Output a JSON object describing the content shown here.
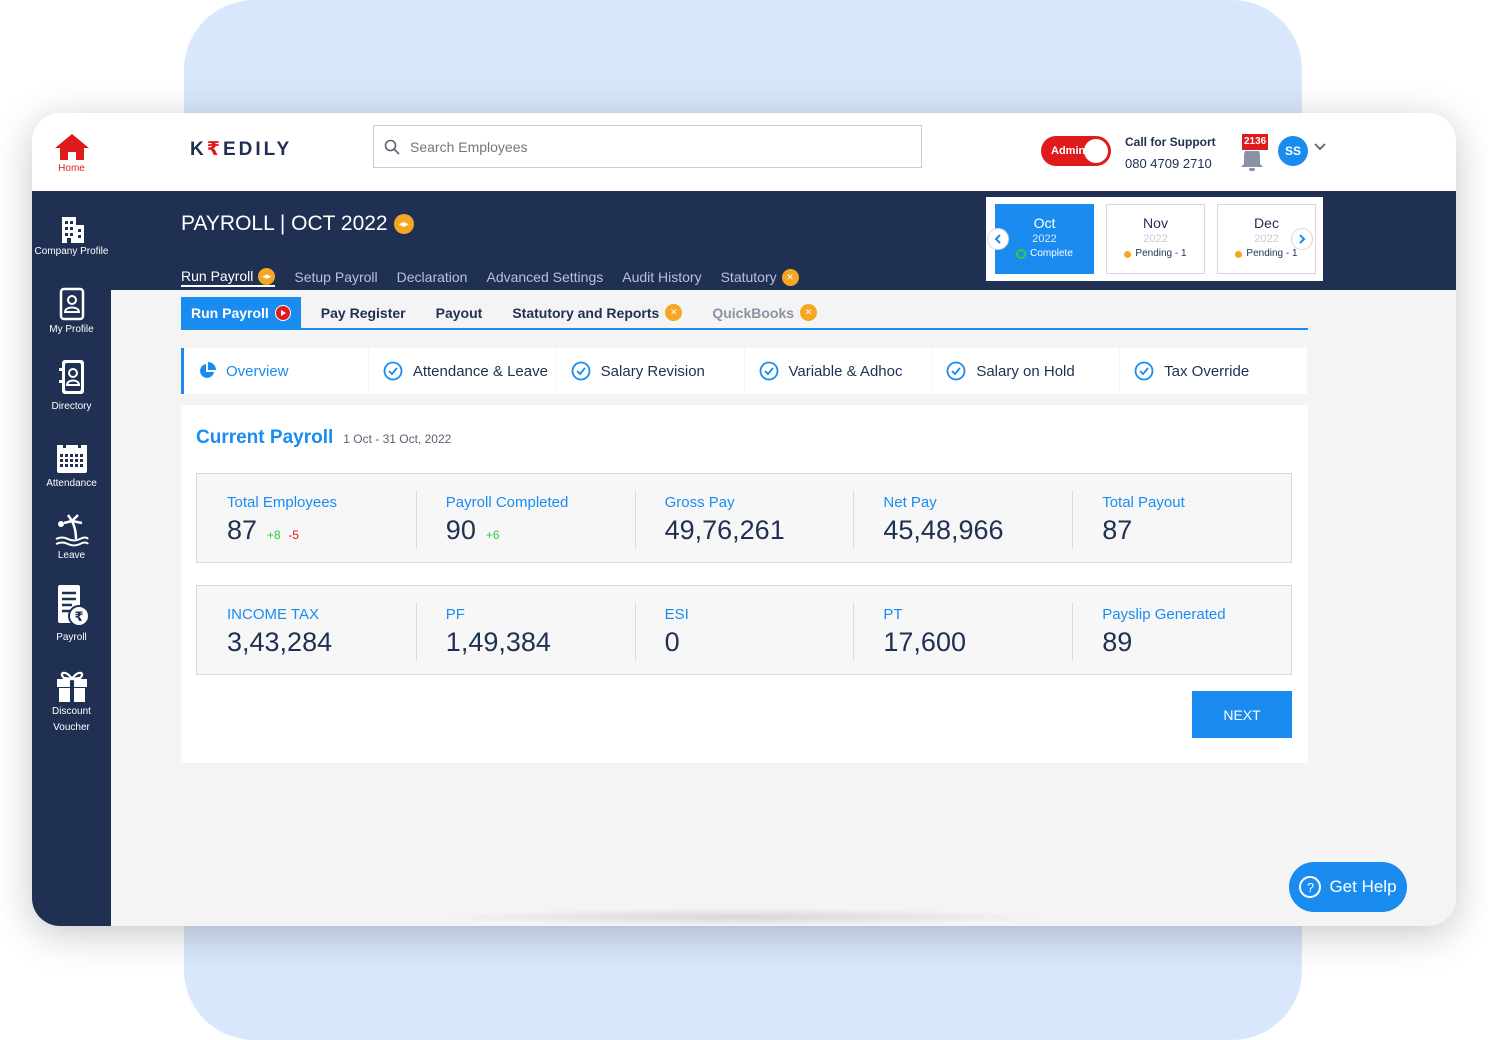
{
  "topbar": {
    "home_label": "Home",
    "logo_pre": "K",
    "logo_r": "₹",
    "logo_post": "EDILY",
    "search_placeholder": "Search Employees",
    "admin_label": "Admin",
    "support_title": "Call for Support",
    "support_phone": "080 4709 2710",
    "notification_count": "2136",
    "avatar_initials": "SS"
  },
  "sidebar": {
    "items": [
      {
        "label": "Company Profile",
        "icon": "building-icon"
      },
      {
        "label": "My Profile",
        "icon": "profile-icon"
      },
      {
        "label": "Directory",
        "icon": "directory-icon"
      },
      {
        "label": "Attendance",
        "icon": "calendar-icon"
      },
      {
        "label": "Leave",
        "icon": "beach-icon"
      },
      {
        "label": "Payroll",
        "icon": "payroll-icon"
      },
      {
        "label": "Discount Voucher",
        "icon": "gift-icon"
      }
    ]
  },
  "header": {
    "title": "PAYROLL | OCT 2022",
    "tabs": [
      "Run Payroll",
      "Setup Payroll",
      "Declaration",
      "Advanced Settings",
      "Audit History",
      "Statutory"
    ]
  },
  "months": [
    {
      "name": "Oct",
      "year": "2022",
      "status": "Complete",
      "active": true
    },
    {
      "name": "Nov",
      "year": "2022",
      "status": "Pending - 1",
      "active": false
    },
    {
      "name": "Dec",
      "year": "2022",
      "status": "Pending - 1",
      "active": false
    }
  ],
  "subtabs": [
    "Run Payroll",
    "Pay Register",
    "Payout",
    "Statutory and Reports",
    "QuickBooks"
  ],
  "steps": [
    "Overview",
    "Attendance & Leave",
    "Salary Revision",
    "Variable & Adhoc",
    "Salary on Hold",
    "Tax Override"
  ],
  "card": {
    "title": "Current Payroll",
    "date_range": "1 Oct - 31 Oct, 2022",
    "row1": [
      {
        "label": "Total Employees",
        "value": "87",
        "up": "+8",
        "down": "-5"
      },
      {
        "label": "Payroll Completed",
        "value": "90",
        "up": "+6",
        "down": ""
      },
      {
        "label": "Gross Pay",
        "value": "49,76,261",
        "up": "",
        "down": ""
      },
      {
        "label": "Net Pay",
        "value": "45,48,966",
        "up": "",
        "down": ""
      },
      {
        "label": "Total Payout",
        "value": "87",
        "up": "",
        "down": ""
      }
    ],
    "row2": [
      {
        "label": "INCOME TAX",
        "value": "3,43,284"
      },
      {
        "label": "PF",
        "value": "1,49,384"
      },
      {
        "label": "ESI",
        "value": "0"
      },
      {
        "label": "PT",
        "value": "17,600"
      },
      {
        "label": "Payslip Generated",
        "value": "89"
      }
    ],
    "next_label": "NEXT"
  },
  "help_label": "Get Help",
  "colors": {
    "navy": "#1f3053",
    "accent": "#1a8cf0",
    "red": "#e01b1b",
    "orange": "#f5a623",
    "green": "#2ecc40"
  }
}
